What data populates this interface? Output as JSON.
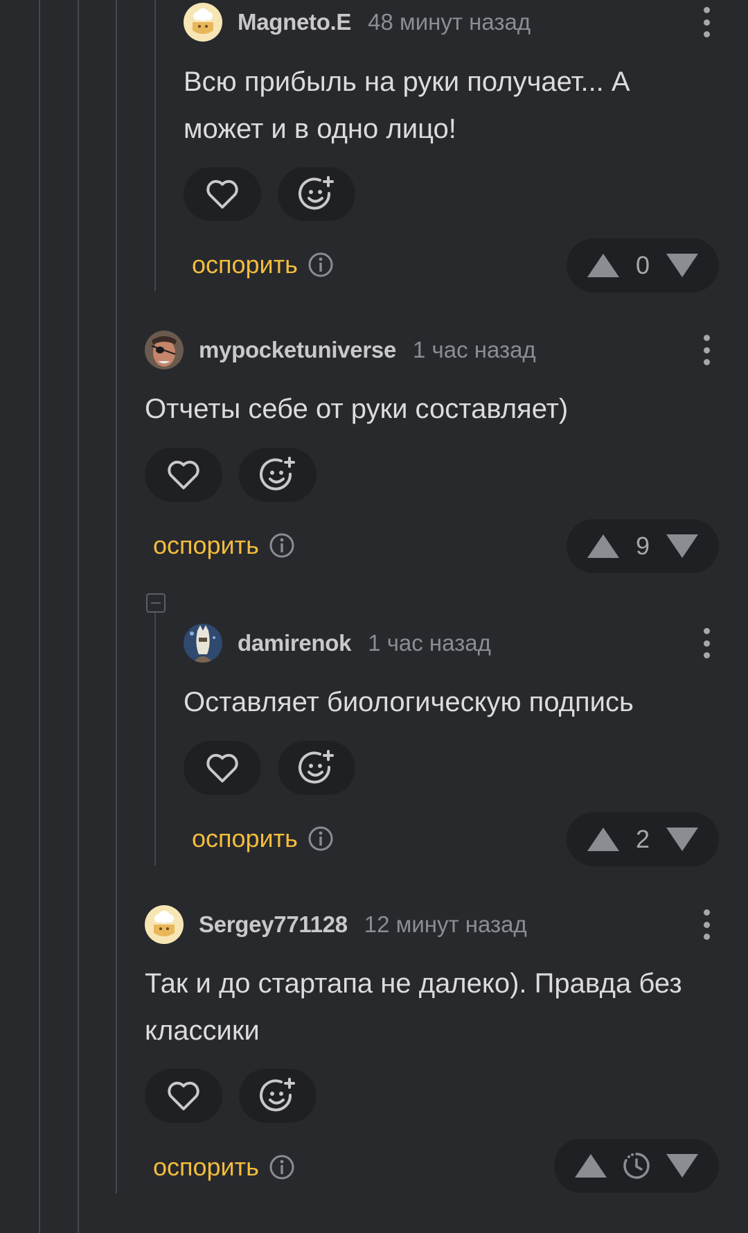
{
  "dispute_label": "оспорить",
  "comments": [
    {
      "author": "Magneto.E",
      "time": "48 минут назад",
      "text": "Всю прибыль на руки получает... А может и в одно лицо!",
      "rating": "0",
      "avatar_icon": "cooking-pot-avatar"
    },
    {
      "author": "mypocketuniverse",
      "time": "1 час назад",
      "text": "Отчеты себе от руки составляет)",
      "rating": "9",
      "avatar_icon": "pirate-eyepatch-avatar"
    },
    {
      "author": "damirenok",
      "time": "1 час назад",
      "text": "Оставляет биологическую подпись",
      "rating": "2",
      "avatar_icon": "horse-knight-avatar"
    },
    {
      "author": "Sergey771128",
      "time": "12 минут назад",
      "text": "Так и до стартапа не далеко). Правда без классики",
      "rating_state": "pending",
      "avatar_icon": "cooking-pot-avatar"
    }
  ],
  "colors": {
    "background": "#28292d",
    "pill": "#1f2023",
    "accent": "#f3bd3c",
    "thread_line": "#46474c"
  }
}
